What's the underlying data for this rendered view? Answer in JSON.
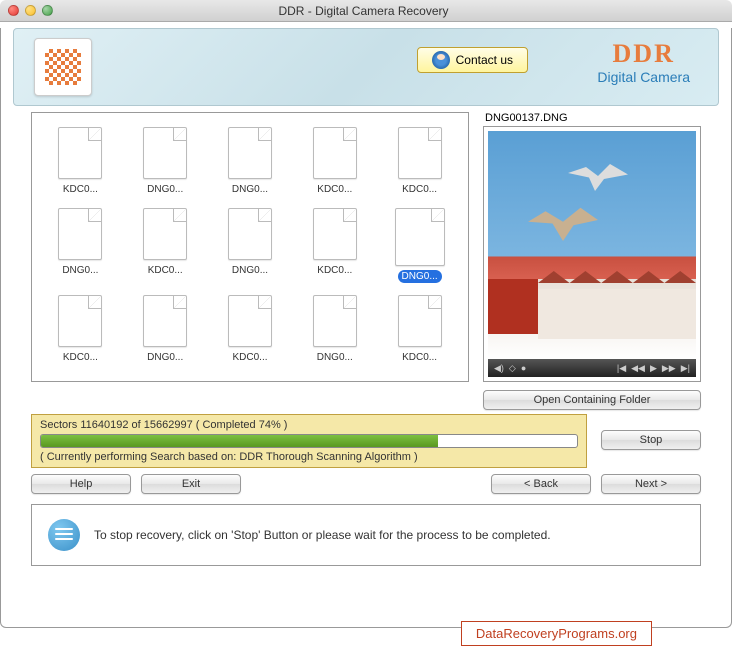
{
  "window": {
    "title": "DDR - Digital Camera Recovery"
  },
  "banner": {
    "contact_label": "Contact us",
    "brand_name": "DDR",
    "brand_subtitle": "Digital Camera"
  },
  "files": [
    {
      "label": "KDC0...",
      "selected": false
    },
    {
      "label": "DNG0...",
      "selected": false
    },
    {
      "label": "DNG0...",
      "selected": false
    },
    {
      "label": "KDC0...",
      "selected": false
    },
    {
      "label": "KDC0...",
      "selected": false
    },
    {
      "label": "DNG0...",
      "selected": false
    },
    {
      "label": "KDC0...",
      "selected": false
    },
    {
      "label": "DNG0...",
      "selected": false
    },
    {
      "label": "KDC0...",
      "selected": false
    },
    {
      "label": "DNG0...",
      "selected": true
    },
    {
      "label": "KDC0...",
      "selected": false
    },
    {
      "label": "DNG0...",
      "selected": false
    },
    {
      "label": "KDC0...",
      "selected": false
    },
    {
      "label": "DNG0...",
      "selected": false
    },
    {
      "label": "KDC0...",
      "selected": false
    }
  ],
  "preview": {
    "filename": "DNG00137.DNG"
  },
  "buttons": {
    "open_folder": "Open Containing Folder",
    "stop": "Stop",
    "help": "Help",
    "exit": "Exit",
    "back": "< Back",
    "next": "Next >"
  },
  "progress": {
    "sectors_current": 11640192,
    "sectors_total": 15662997,
    "percent": 74,
    "text": "Sectors 11640192 of 15662997   ( Completed 74% )",
    "algorithm": "( Currently performing Search based on: DDR Thorough Scanning Algorithm )"
  },
  "tip": {
    "text": "To stop recovery, click on 'Stop' Button or please wait for the process to be completed."
  },
  "footer": {
    "link": "DataRecoveryPrograms.org"
  }
}
